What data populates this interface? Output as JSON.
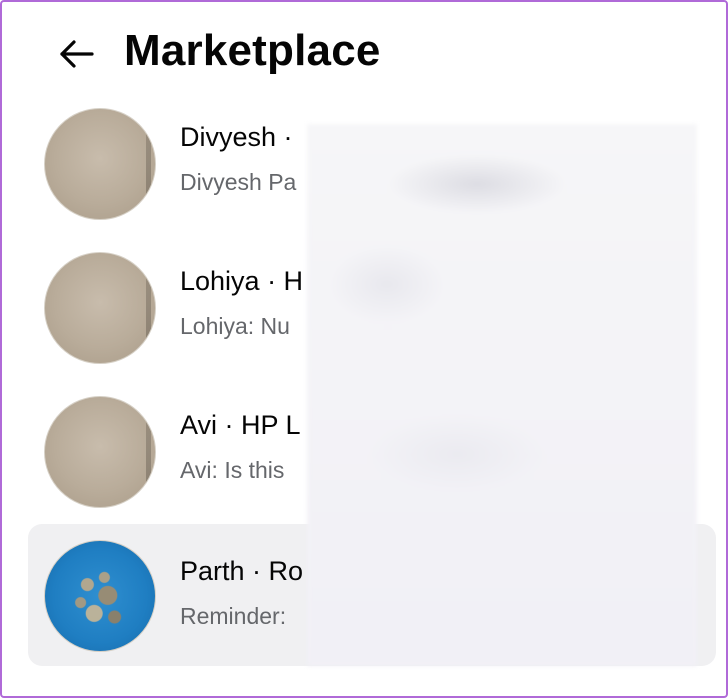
{
  "header": {
    "title": "Marketplace",
    "back_icon": "arrow-left-icon"
  },
  "conversations": [
    {
      "name": "Divyesh ·",
      "preview": "Divyesh Pa",
      "avatar": "beige-photo",
      "active": false
    },
    {
      "name": "Lohiya · H",
      "preview": "Lohiya: Nu",
      "avatar": "beige-photo",
      "active": false
    },
    {
      "name": "Avi · HP L",
      "preview": "Avi: Is this",
      "avatar": "beige-photo",
      "active": false
    },
    {
      "name": "Parth · Ro",
      "preview": "Reminder:",
      "avatar": "blue-photo",
      "active": true
    }
  ],
  "colors": {
    "frame_border": "#b06ad8",
    "title": "#050505",
    "preview": "#65676b",
    "active_row": "#f0f0f2"
  }
}
